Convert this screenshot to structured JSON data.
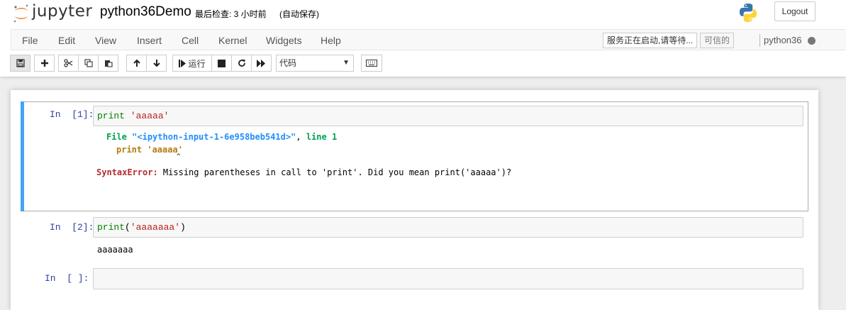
{
  "header": {
    "logo_text": "jupyter",
    "notebook_title": "python36Demo",
    "checkpoint": "最后检查: 3 小时前",
    "autosave": "(自动保存)",
    "logout_label": "Logout"
  },
  "menubar": {
    "items": [
      "File",
      "Edit",
      "View",
      "Insert",
      "Cell",
      "Kernel",
      "Widgets",
      "Help"
    ],
    "kernel_status": "服务正在启动,请等待...",
    "trusted": "可信的",
    "kernel_name": "python36"
  },
  "toolbar": {
    "icons": [
      "save-icon",
      "plus-icon",
      "cut-icon",
      "copy-icon",
      "paste-icon",
      "arrow-up-icon",
      "arrow-down-icon",
      "step-forward-icon",
      "stop-icon",
      "redo-icon",
      "fast-forward-icon",
      "keyboard-icon"
    ],
    "run_label": "运行",
    "cell_type": "代码"
  },
  "cells": [
    {
      "prompt": "In  [1]:",
      "code": {
        "func": "print",
        "str": "'aaaaa'"
      },
      "output": {
        "file_kw": "File",
        "file_name": "\"<ipython-input-1-6e958beb541d>\"",
        "comma": ",",
        "line_kw": "line",
        "line_num": "1",
        "code_line": "print 'aaaaa'",
        "caret": "^",
        "error_name": "SyntaxError:",
        "error_msg": " Missing parentheses in call to 'print'. Did you mean print('aaaaa')?"
      }
    },
    {
      "prompt": "In  [2]:",
      "code": {
        "func": "print",
        "open": "(",
        "str": "'aaaaaaa'",
        "close": ")"
      },
      "output": {
        "text": "aaaaaaa"
      }
    },
    {
      "prompt": "In  [ ]:",
      "code": {}
    }
  ],
  "colors": {
    "accent": "#42a5f5",
    "prompt": "#303f9f",
    "error": "#b22b31",
    "keyword": "#008000",
    "string": "#ba2121"
  }
}
